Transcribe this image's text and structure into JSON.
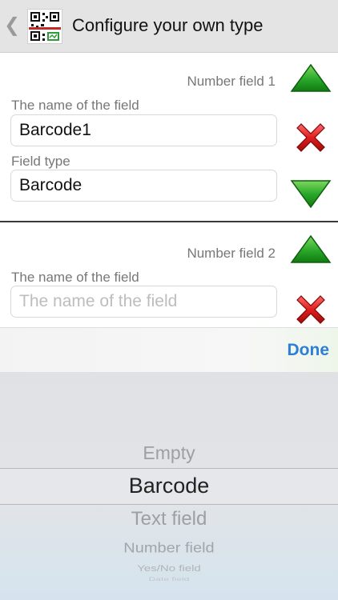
{
  "header": {
    "title": "Configure your own type",
    "back_glyph": "❮"
  },
  "fields": [
    {
      "number_label": "Number field 1",
      "name_label": "The name of the field",
      "name_value": "Barcode1",
      "type_label": "Field type",
      "type_value": "Barcode"
    },
    {
      "number_label": "Number field 2",
      "name_label": "The name of the field",
      "name_placeholder": "The name of the field"
    }
  ],
  "toolbar": {
    "done_label": "Done"
  },
  "picker": {
    "options": [
      "Empty",
      "Barcode",
      "Text  field",
      "Number field",
      "Yes/No field",
      "Date field"
    ],
    "selected": "Barcode"
  },
  "colors": {
    "accent": "#2d7fd3",
    "up_arrow": "#1d9a1d",
    "down_arrow": "#1d9a1d",
    "delete": "#d81e1e"
  },
  "icons": {
    "back": "chevron-left-icon",
    "app": "qr-code-icon",
    "move_up": "arrow-up-icon",
    "move_down": "arrow-down-icon",
    "delete": "delete-x-icon"
  }
}
